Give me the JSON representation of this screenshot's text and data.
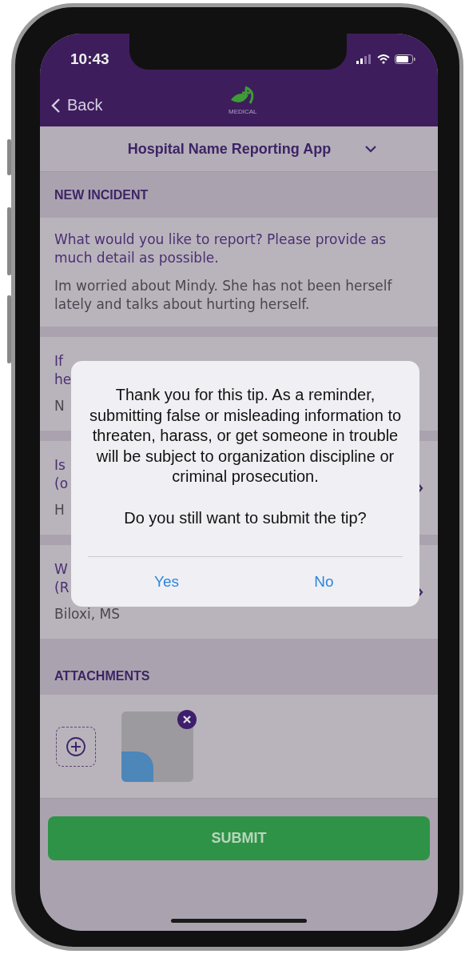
{
  "status_bar": {
    "time": "10:43"
  },
  "nav": {
    "back_label": "Back",
    "logo_text": "MEDICAL"
  },
  "app_selector": {
    "title": "Hospital Name Reporting App"
  },
  "new_incident": {
    "header": "NEW INCIDENT",
    "question": "What would you like to report? Please provide as much detail as possible.",
    "answer": "Im worried about Mindy. She has not been herself lately and talks about hurting herself."
  },
  "fields": [
    {
      "kind": "text",
      "label_lines": [
        "If",
        "he"
      ],
      "value": "N"
    },
    {
      "kind": "picker",
      "label_lines": [
        "Is",
        "(o"
      ],
      "value": "H"
    },
    {
      "kind": "picker",
      "label_lines": [
        "W",
        "(R"
      ],
      "value": "Biloxi, MS"
    }
  ],
  "attachments": {
    "header": "ATTACHMENTS"
  },
  "submit": {
    "label": "SUBMIT"
  },
  "dialog": {
    "message": "Thank you for this tip. As a reminder, submitting false or misleading information to threaten, harass, or get someone in trouble will be subject to organization discipline or criminal prosecution.",
    "question": "Do you still want to submit the tip?",
    "buttons": [
      "Yes",
      "No"
    ]
  }
}
